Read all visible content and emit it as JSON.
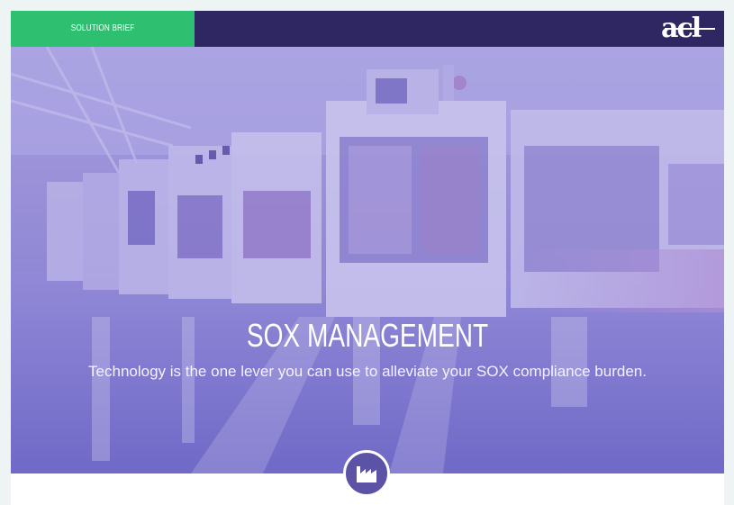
{
  "header": {
    "badge_label": "SOLUTION BRIEF",
    "logo_text": "acl",
    "logo_icon": "acl-logo"
  },
  "hero": {
    "title": "SOX MANAGEMENT",
    "subtitle": "Technology is the one lever you can use to alleviate your SOX compliance burden.",
    "image_icon": "factory-production-line-photo"
  },
  "section_icon": "factory-icon",
  "colors": {
    "header_bg": "#2f2762",
    "badge_bg": "#2fbf71",
    "hero_tint": "#8f88d2",
    "icon_bg": "#5c53a6"
  }
}
